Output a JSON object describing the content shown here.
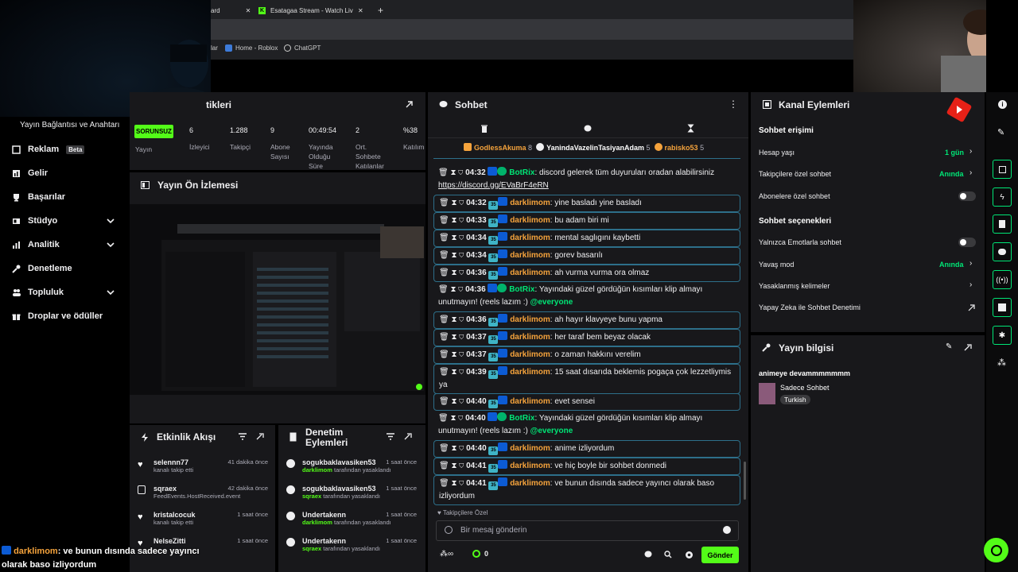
{
  "browser": {
    "tabs": [
      {
        "label": "ard"
      },
      {
        "label": "Esatagaa Stream - Watch Live o"
      }
    ],
    "new_tab": "+",
    "bookmarks": [
      {
        "label": "lar"
      },
      {
        "label": "Home - Roblox"
      },
      {
        "label": "ChatGPT"
      }
    ]
  },
  "sidebar": {
    "stream_key_label": "Yayın Bağlantısı ve Anahtarı",
    "items": [
      {
        "label": "Reklam",
        "badge": "Beta",
        "icon": "megaphone-icon"
      },
      {
        "label": "Gelir",
        "icon": "chart-icon"
      },
      {
        "label": "Başarılar",
        "icon": "trophy-icon"
      },
      {
        "label": "Stüdyo",
        "icon": "studio-icon",
        "expandable": true
      },
      {
        "label": "Analitik",
        "icon": "analytics-icon",
        "expandable": true
      },
      {
        "label": "Denetleme",
        "icon": "wrench-icon"
      },
      {
        "label": "Topluluk",
        "icon": "people-icon",
        "expandable": true
      },
      {
        "label": "Droplar ve ödüller",
        "icon": "gift-icon"
      }
    ]
  },
  "stats": {
    "title_fragment": "tikleri",
    "status": "SORUNSUZ",
    "status_label": "Yayın",
    "items": [
      {
        "value": "6",
        "label": "İzleyici"
      },
      {
        "value": "1.288",
        "label": "Takipçi"
      },
      {
        "value": "9",
        "label": "Abone Sayısı"
      },
      {
        "value": "00:49:54",
        "label": "Yayında Olduğu Süre"
      },
      {
        "value": "2",
        "label": "Ort. Sohbete Katılanlar"
      },
      {
        "value": "%38",
        "label": "Katılım"
      }
    ]
  },
  "preview": {
    "title": "Yayın Ön İzlemesi"
  },
  "activity": {
    "title": "Etkinlik Akışı",
    "items": [
      {
        "name": "selennn77",
        "sub": "kanalı takip etti",
        "time": "41 dakika önce",
        "icon": "heart-icon"
      },
      {
        "name": "sqraex",
        "sub": "FeedEvents.HostReceived.event",
        "time": "42 dakika önce",
        "icon": "host-icon"
      },
      {
        "name": "kristalcocuk",
        "sub": "kanalı takip etti",
        "time": "1 saat önce",
        "icon": "heart-icon"
      },
      {
        "name": "NelseZitti",
        "sub": "",
        "time": "1 saat önce",
        "icon": "heart-icon"
      }
    ]
  },
  "moderation": {
    "title": "Denetim Eylemleri",
    "items": [
      {
        "name": "sogukbaklavasiken53",
        "by": "darklimom",
        "suffix": "tarafından yasaklandı",
        "time": "1 saat önce"
      },
      {
        "name": "sogukbaklavasiken53",
        "by": "sqraex",
        "suffix": "tarafından yasaklandı",
        "time": "1 saat önce"
      },
      {
        "name": "Undertakenn",
        "by": "darklimom",
        "suffix": "tarafından yasaklandı",
        "time": "1 saat önce"
      },
      {
        "name": "Undertakenn",
        "by": "sqraex",
        "suffix": "tarafından yasaklandı",
        "time": "1 saat önce"
      }
    ]
  },
  "chat": {
    "title": "Sohbet",
    "top_gifters": [
      {
        "name": "GodlessAkuma",
        "count": "8",
        "color": "#f5a33c"
      },
      {
        "name": "YanindaVazelinTasiyanAdam",
        "count": "5",
        "color": "#efeff1"
      },
      {
        "name": "rabisko53",
        "count": "5",
        "color": "#f5a33c"
      }
    ],
    "messages": [
      {
        "time": "04:32",
        "user": "BotRix",
        "bot": true,
        "text": "discord gelerek tüm duyuruları oradan alabilirsiniz",
        "link": "https://discord.gg/EVaBrF4eRN",
        "boxed": false
      },
      {
        "time": "04:32",
        "user": "darklimom",
        "text": "yine basladı yine basladı",
        "boxed": true
      },
      {
        "time": "04:33",
        "user": "darklimom",
        "text": "bu adam biri mi",
        "boxed": true
      },
      {
        "time": "04:34",
        "user": "darklimom",
        "text": "mental saglıgını kaybetti",
        "boxed": true
      },
      {
        "time": "04:34",
        "user": "darklimom",
        "text": "gorev basarılı",
        "boxed": true
      },
      {
        "time": "04:36",
        "user": "darklimom",
        "text": "ah vurma vurma ora olmaz",
        "boxed": true
      },
      {
        "time": "04:36",
        "user": "BotRix",
        "bot": true,
        "text": "Yayındaki güzel gördüğün kısımları klip almayı unutmayın! (reels lazım :)",
        "mention": "@everyone",
        "boxed": false
      },
      {
        "time": "04:36",
        "user": "darklimom",
        "text": "ah hayır klavyeye bunu yapma",
        "boxed": true
      },
      {
        "time": "04:37",
        "user": "darklimom",
        "text": "her taraf bem beyaz olacak",
        "boxed": true
      },
      {
        "time": "04:37",
        "user": "darklimom",
        "text": "o zaman hakkını verelim",
        "boxed": true
      },
      {
        "time": "04:39",
        "user": "darklimom",
        "text": "15 saat dısarıda beklemis pogaça çok lezzetliymis ya",
        "boxed": true
      },
      {
        "time": "04:40",
        "user": "darklimom",
        "text": "evet sensei",
        "boxed": true
      },
      {
        "time": "04:40",
        "user": "BotRix",
        "bot": true,
        "text": "Yayındaki güzel gördüğün kısımları klip almayı unutmayın! (reels lazım :)",
        "mention": "@everyone",
        "boxed": false
      },
      {
        "time": "04:40",
        "user": "darklimom",
        "text": "anime izliyordum",
        "boxed": true
      },
      {
        "time": "04:41",
        "user": "darklimom",
        "text": "ve hiç boyle bir sohbet donmedi",
        "boxed": true
      },
      {
        "time": "04:41",
        "user": "darklimom",
        "text": "ve bunun dısında sadece yayıncı olarak baso izliyordum",
        "boxed": true
      }
    ],
    "followers_only": "Takipçilere Özel",
    "input_placeholder": "Bir mesaj gönderin",
    "points": "0",
    "send_label": "Gönder"
  },
  "channel": {
    "title": "Kanal Eylemleri",
    "chat_access": "Sohbet erişimi",
    "rows_access": [
      {
        "label": "Hesap yaşı",
        "value": "1 gün",
        "kind": "arrow"
      },
      {
        "label": "Takipçilere özel sohbet",
        "value": "Anında",
        "kind": "arrow"
      },
      {
        "label": "Abonelere özel sohbet",
        "value": "",
        "kind": "toggle"
      }
    ],
    "chat_options": "Sohbet seçenekleri",
    "rows_options": [
      {
        "label": "Yalnızca Emotlarla sohbet",
        "value": "",
        "kind": "toggle"
      },
      {
        "label": "Yavaş mod",
        "value": "Anında",
        "kind": "arrow"
      },
      {
        "label": "Yasaklanmış kelimeler",
        "value": "",
        "kind": "arrow"
      },
      {
        "label": "Yapay Zeka ile Sohbet Denetimi",
        "value": "",
        "kind": "external"
      }
    ]
  },
  "stream_info": {
    "title": "Yayın bilgisi",
    "stream_title": "animeye devammmmmmm",
    "category": "Sadece Sohbet",
    "language": "Turkish"
  },
  "overlay": {
    "user": "darklimom",
    "text": ": ve bunun dısında sadece yayıncı olarak baso izliyordum"
  },
  "colors": {
    "accent": "#53fc18",
    "panel": "#18181b",
    "bot": "#00e676",
    "user": "#f5a33c"
  }
}
